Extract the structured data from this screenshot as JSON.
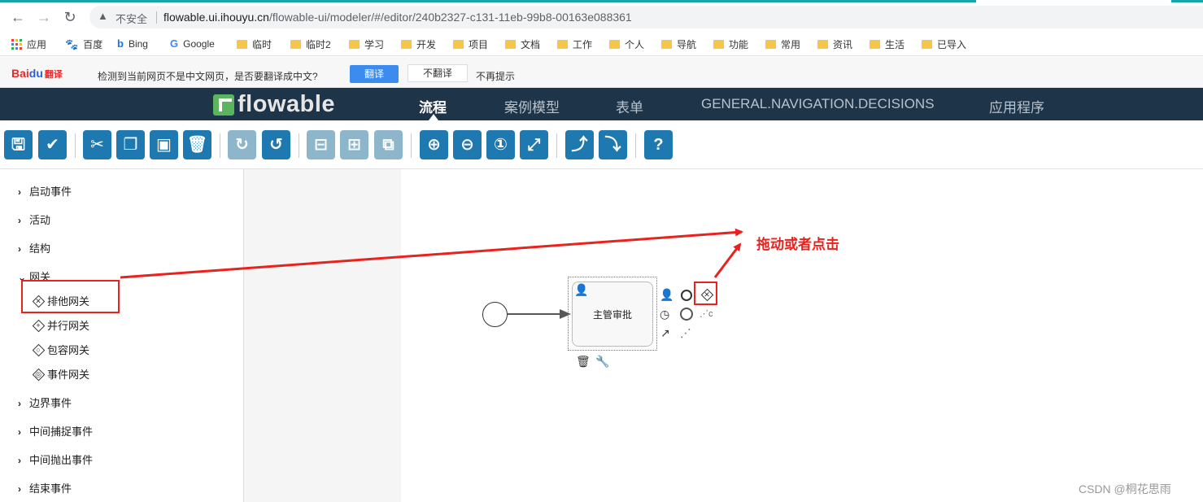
{
  "browser": {
    "security_label": "不安全",
    "url_host": "flowable.ui.ihouyu.cn",
    "url_path": "/flowable-ui/modeler/#/editor/240b2327-c131-11eb-99b8-00163e088361"
  },
  "bookmarks": [
    "应用",
    "百度",
    "Bing",
    "Google",
    "临时",
    "临时2",
    "学习",
    "开发",
    "项目",
    "文档",
    "工作",
    "个人",
    "导航",
    "功能",
    "常用",
    "资讯",
    "生活",
    "已导入"
  ],
  "translate_bar": {
    "logo_a": "Bai",
    "logo_b": "du",
    "logo_c": "翻译",
    "message": "检测到当前网页不是中文网页，是否要翻译成中文?",
    "translate_button": "翻译",
    "no_translate_button": "不翻译",
    "never_button": "不再提示"
  },
  "app": {
    "brand": "flowable",
    "nav": [
      "流程",
      "案例模型",
      "表单",
      "GENERAL.NAVIGATION.DECISIONS",
      "应用程序"
    ],
    "active_nav": "流程"
  },
  "palette": {
    "groups": [
      "启动事件",
      "活动",
      "结构",
      "网关",
      "边界事件",
      "中间捕捉事件",
      "中间抛出事件",
      "结束事件"
    ],
    "expanded_group": "网关",
    "gateway_items": [
      "排他网关",
      "并行网关",
      "包容网关",
      "事件网关"
    ]
  },
  "diagram": {
    "task_name": "主管审批"
  },
  "annotation": {
    "text": "拖动或者点击"
  },
  "watermark": "CSDN @桐花思雨",
  "colors": {
    "header_bg": "#1e3448",
    "toolbar_button": "#1f79b1",
    "highlight": "#e8231e"
  }
}
